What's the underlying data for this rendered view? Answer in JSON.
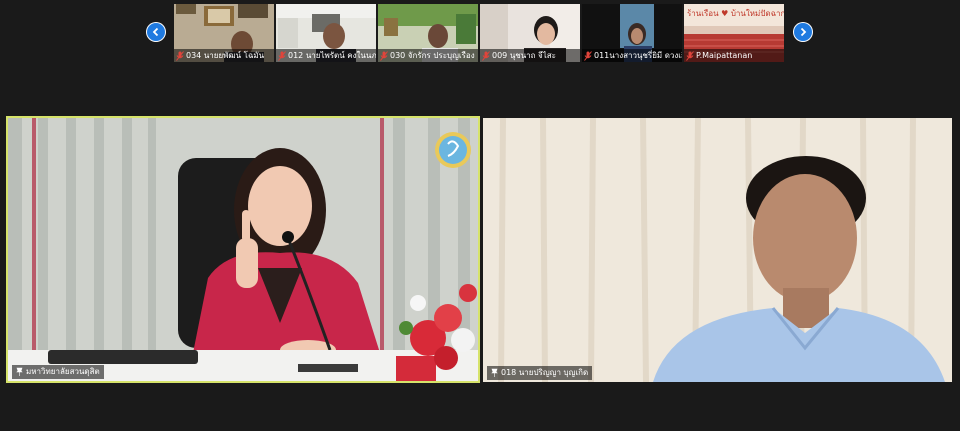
{
  "gallery": {
    "prev_label": "‹",
    "next_label": "›",
    "participants": [
      {
        "name": "034 นายยพัฒน์ โฉมัน",
        "muted": true
      },
      {
        "name": "012 นายไพรัตน์ คงในนภ",
        "muted": true
      },
      {
        "name": "030 จักรักร ประบุญเรือง",
        "muted": true
      },
      {
        "name": "009 นุชนาถ จีไสะ",
        "muted": true
      },
      {
        "name": "011นางสาวนุชรี่ยิมี ดวงเกิด",
        "muted": true
      },
      {
        "name": "P.Maipattanan",
        "muted": true
      }
    ]
  },
  "speaker": {
    "left_name": "มหาวิทยาลัยสวนดุสิต",
    "right_name": "018 นายปริญญา บุญเกิด"
  },
  "banner_text": "ร้านเรือน ♥ บ้านใหม่ปัดฉาก",
  "colors": {
    "accent": "#1f7ae0",
    "active_border": "#d6e36a",
    "muted_icon": "#e0443b"
  }
}
